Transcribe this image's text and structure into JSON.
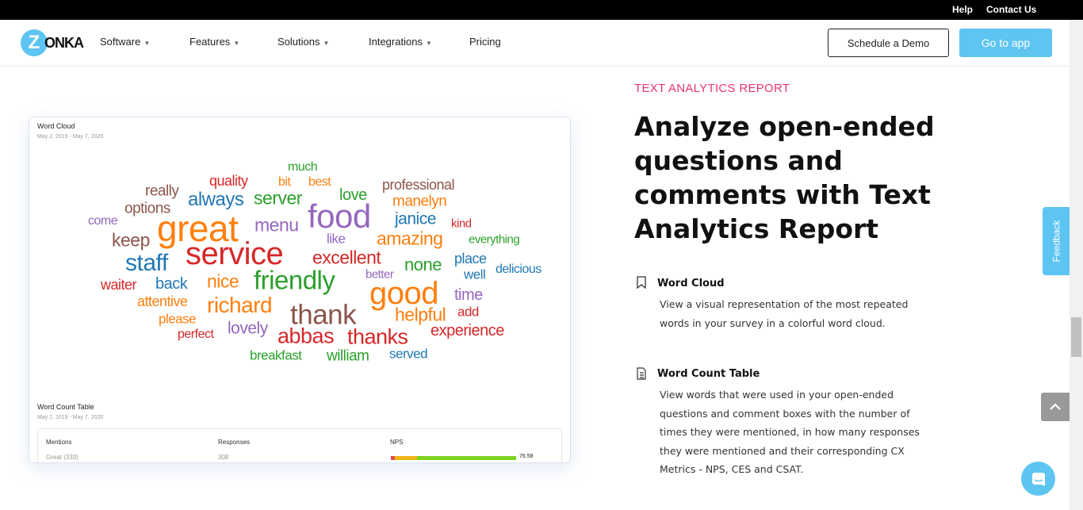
{
  "topbar": {
    "help": "Help",
    "contact": "Contact Us"
  },
  "nav": {
    "logo_letter": "Z",
    "logo_text": "ONKA",
    "items": [
      {
        "label": "Software",
        "dropdown": true
      },
      {
        "label": "Features",
        "dropdown": true
      },
      {
        "label": "Solutions",
        "dropdown": true
      },
      {
        "label": "Integrations",
        "dropdown": true
      },
      {
        "label": "Pricing",
        "dropdown": false
      }
    ],
    "schedule_demo": "Schedule a Demo",
    "go_to_app": "Go to app",
    "caret": "▼"
  },
  "card": {
    "word_cloud_title": "Word Cloud",
    "word_cloud_date": "May 2, 2019 - May 7, 2020",
    "words": [
      {
        "text": "much",
        "color": "#2ca02c"
      },
      {
        "text": "quality",
        "color": "#d62728"
      },
      {
        "text": "bit",
        "color": "#ff7f0e"
      },
      {
        "text": "best",
        "color": "#ff7f0e"
      },
      {
        "text": "professional",
        "color": "#8c564b"
      },
      {
        "text": "really",
        "color": "#8c564b"
      },
      {
        "text": "always",
        "color": "#1f77b4"
      },
      {
        "text": "server",
        "color": "#2ca02c"
      },
      {
        "text": "love",
        "color": "#2ca02c"
      },
      {
        "text": "manelyn",
        "color": "#ff7f0e"
      },
      {
        "text": "options",
        "color": "#8c564b"
      },
      {
        "text": "food",
        "color": "#9467bd"
      },
      {
        "text": "come",
        "color": "#9467bd"
      },
      {
        "text": "great",
        "color": "#ff7f0e"
      },
      {
        "text": "menu",
        "color": "#9467bd"
      },
      {
        "text": "janice",
        "color": "#1f77b4"
      },
      {
        "text": "kind",
        "color": "#d62728"
      },
      {
        "text": "keep",
        "color": "#8c564b"
      },
      {
        "text": "like",
        "color": "#9467bd"
      },
      {
        "text": "amazing",
        "color": "#ff7f0e"
      },
      {
        "text": "everything",
        "color": "#2ca02c"
      },
      {
        "text": "service",
        "color": "#d62728"
      },
      {
        "text": "excellent",
        "color": "#d62728"
      },
      {
        "text": "staff",
        "color": "#1f77b4"
      },
      {
        "text": "none",
        "color": "#2ca02c"
      },
      {
        "text": "place",
        "color": "#1f77b4"
      },
      {
        "text": "better",
        "color": "#9467bd"
      },
      {
        "text": "well",
        "color": "#1f77b4"
      },
      {
        "text": "delicious",
        "color": "#1f77b4"
      },
      {
        "text": "waiter",
        "color": "#d62728"
      },
      {
        "text": "back",
        "color": "#1f77b4"
      },
      {
        "text": "nice",
        "color": "#ff7f0e"
      },
      {
        "text": "friendly",
        "color": "#2ca02c"
      },
      {
        "text": "good",
        "color": "#ff7f0e"
      },
      {
        "text": "time",
        "color": "#9467bd"
      },
      {
        "text": "attentive",
        "color": "#ff7f0e"
      },
      {
        "text": "richard",
        "color": "#ff7f0e"
      },
      {
        "text": "thank",
        "color": "#8c564b"
      },
      {
        "text": "helpful",
        "color": "#ff7f0e"
      },
      {
        "text": "add",
        "color": "#d62728"
      },
      {
        "text": "please",
        "color": "#ff7f0e"
      },
      {
        "text": "lovely",
        "color": "#9467bd"
      },
      {
        "text": "perfect",
        "color": "#d62728"
      },
      {
        "text": "abbas",
        "color": "#d62728"
      },
      {
        "text": "thanks",
        "color": "#d62728"
      },
      {
        "text": "experience",
        "color": "#d62728"
      },
      {
        "text": "breakfast",
        "color": "#2ca02c"
      },
      {
        "text": "william",
        "color": "#2ca02c"
      },
      {
        "text": "served",
        "color": "#1f77b4"
      }
    ],
    "word_count_title": "Word Count Table",
    "word_count_date": "May 2, 2019 - May 7, 2020",
    "table": {
      "headers": [
        "Mentions",
        "Responses",
        "NPS"
      ],
      "row": {
        "mention": "Great (333)",
        "responses": "308",
        "nps": "76.58"
      },
      "nps_bar": [
        {
          "share": 0.03,
          "color": "#e84c4c"
        },
        {
          "share": 0.18,
          "color": "#f0b619"
        },
        {
          "share": 0.79,
          "color": "#7ed321"
        }
      ]
    }
  },
  "content": {
    "eyebrow": "TEXT ANALYTICS REPORT",
    "heading": "Analyze open-ended questions and comments with Text Analytics Report",
    "features": [
      {
        "icon": "bookmark-icon",
        "title": "Word Cloud",
        "desc": "View a visual representation of the most repeated words in your survey in a colorful word cloud."
      },
      {
        "icon": "document-icon",
        "title": "Word Count Table",
        "desc": "View words that were used in your open-ended questions and comment boxes with the number of times they were mentioned, in how many responses they were mentioned and their corresponding CX Metrics - NPS, CES and CSAT."
      }
    ]
  },
  "widgets": {
    "feedback": "Feedback"
  },
  "colors": {
    "accent": "#5ec5f2",
    "eyebrow": "#e8337a"
  }
}
